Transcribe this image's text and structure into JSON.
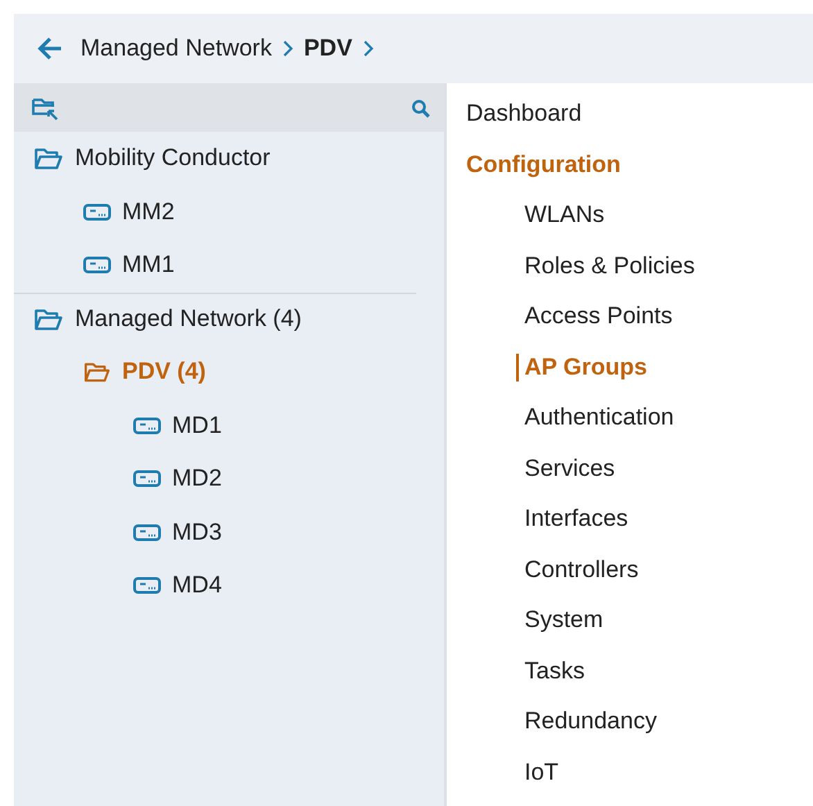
{
  "breadcrumb": {
    "items": [
      {
        "label": "Managed Network",
        "current": false
      },
      {
        "label": "PDV",
        "current": true
      }
    ]
  },
  "tree": [
    {
      "kind": "folder",
      "label": "Mobility Conductor",
      "selected": false,
      "children": [
        {
          "kind": "device",
          "label": "MM2",
          "selected": false
        },
        {
          "kind": "device",
          "label": "MM1",
          "selected": false
        }
      ]
    },
    {
      "kind": "folder",
      "label": "Managed Network (4)",
      "selected": false,
      "children": [
        {
          "kind": "folder",
          "label": "PDV (4)",
          "selected": true,
          "children": [
            {
              "kind": "device",
              "label": "MD1",
              "selected": false
            },
            {
              "kind": "device",
              "label": "MD2",
              "selected": false
            },
            {
              "kind": "device",
              "label": "MD3",
              "selected": false
            },
            {
              "kind": "device",
              "label": "MD4",
              "selected": false
            }
          ]
        }
      ]
    }
  ],
  "menu": [
    {
      "label": "Dashboard",
      "selected": false
    },
    {
      "label": "Configuration",
      "selected": true,
      "children": [
        {
          "label": "WLANs",
          "selected": false
        },
        {
          "label": "Roles & Policies",
          "selected": false
        },
        {
          "label": "Access Points",
          "selected": false
        },
        {
          "label": "AP Groups",
          "selected": true
        },
        {
          "label": "Authentication",
          "selected": false
        },
        {
          "label": "Services",
          "selected": false
        },
        {
          "label": "Interfaces",
          "selected": false
        },
        {
          "label": "Controllers",
          "selected": false
        },
        {
          "label": "System",
          "selected": false
        },
        {
          "label": "Tasks",
          "selected": false
        },
        {
          "label": "Redundancy",
          "selected": false
        },
        {
          "label": "IoT",
          "selected": false
        }
      ]
    }
  ]
}
